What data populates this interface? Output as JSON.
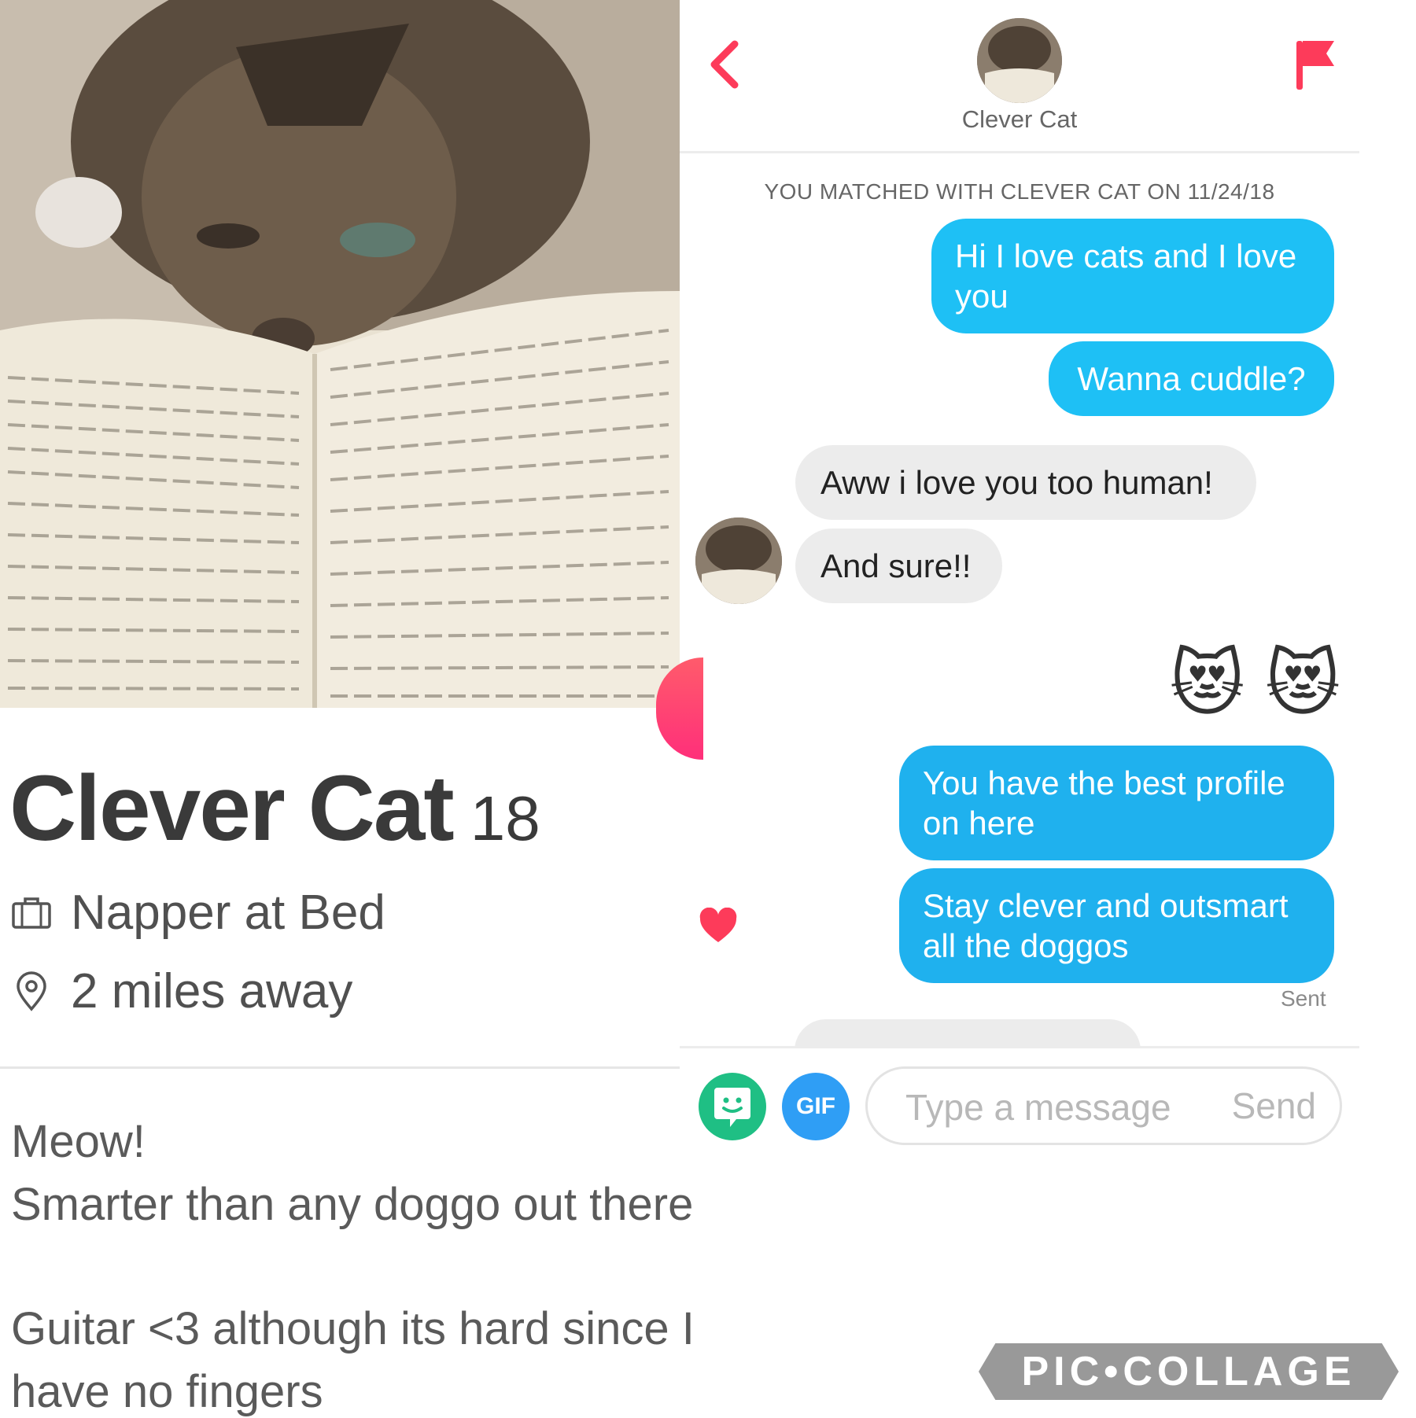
{
  "profile": {
    "name": "Clever Cat",
    "age": "18",
    "job": "Napper at Bed",
    "distance": "2 miles away",
    "bio_lines": [
      "Meow!",
      "Smarter than any doggo out there",
      "",
      "Guitar <3 although its hard since I",
      "have no fingers"
    ],
    "icons": {
      "job": "briefcase-icon",
      "distance": "location-pin-icon"
    }
  },
  "chat": {
    "header_name": "Clever Cat",
    "matched_text": "YOU MATCHED WITH CLEVER CAT ON 11/24/18",
    "messages": [
      {
        "from": "me",
        "text": "Hi I love cats and I love you"
      },
      {
        "from": "me",
        "text": "Wanna cuddle?"
      },
      {
        "from": "them",
        "text": "Aww i love you too human!"
      },
      {
        "from": "them",
        "text": "And sure!!"
      },
      {
        "from": "me",
        "text": "😻 😻"
      },
      {
        "from": "me",
        "text": "You have the best profile on here"
      },
      {
        "from": "me",
        "text": "Stay clever and outsmart all the doggos"
      }
    ],
    "sent_label": "Sent",
    "input_placeholder": "Type a message",
    "send_label": "Send",
    "gif_label": "GIF"
  },
  "watermark": "PIC•COLLAGE",
  "colors": {
    "accent": "#fd3b5a",
    "outgoing_bubble": "#1ec0f5",
    "incoming_bubble": "#ececec"
  }
}
